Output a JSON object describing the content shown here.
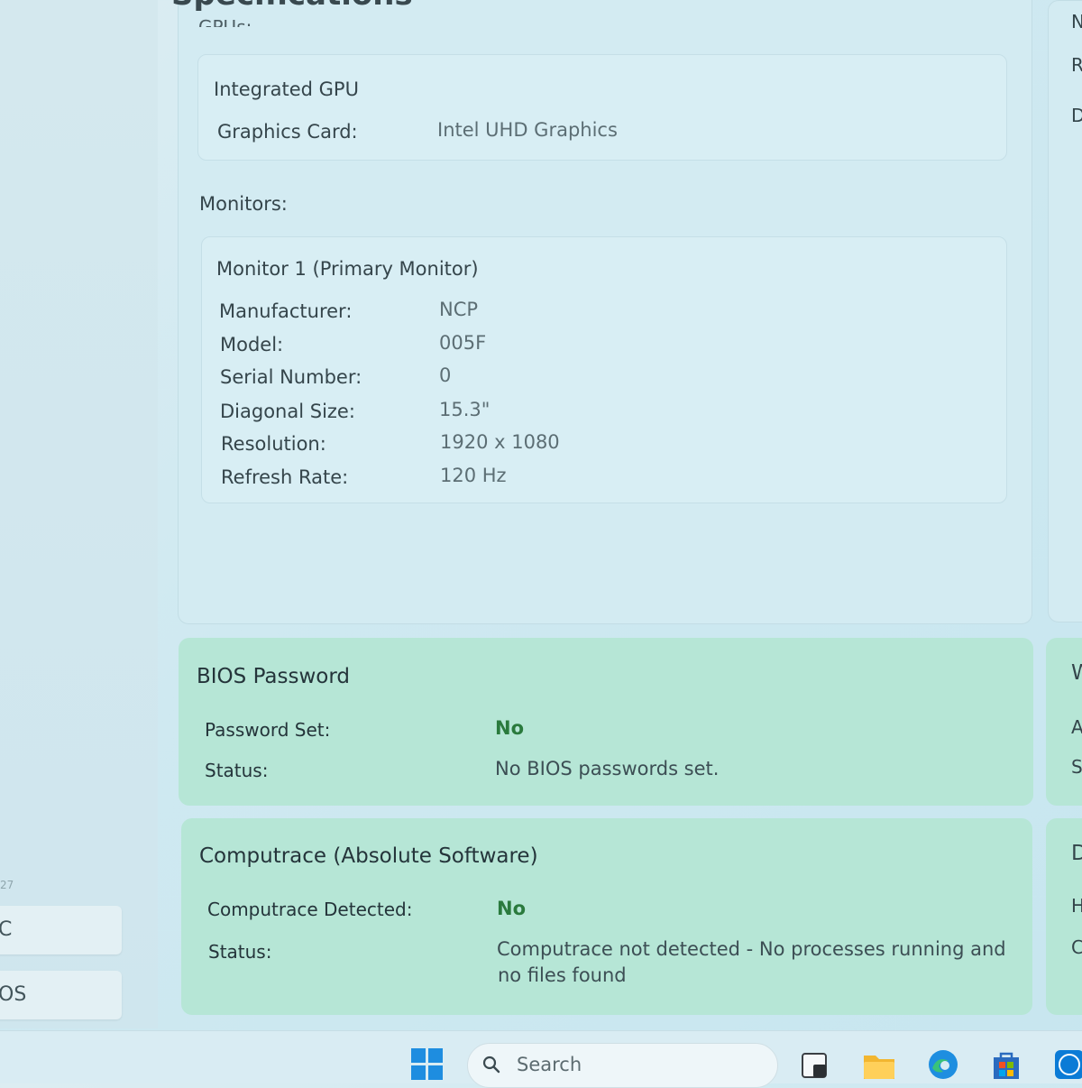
{
  "header": {
    "title": "Specifications",
    "gpu_heading": "GPUs:"
  },
  "gpu": {
    "card_title": "Integrated GPU",
    "graphics_label": "Graphics Card:",
    "graphics_value": "Intel UHD Graphics"
  },
  "monitors": {
    "section_label": "Monitors:",
    "card_title": "Monitor 1 (Primary Monitor)",
    "rows": [
      {
        "label": "Manufacturer:",
        "value": "NCP"
      },
      {
        "label": "Model:",
        "value": "005F"
      },
      {
        "label": "Serial Number:",
        "value": "0"
      },
      {
        "label": "Diagonal Size:",
        "value": "15.3\""
      },
      {
        "label": "Resolution:",
        "value": "1920 x 1080"
      },
      {
        "label": "Refresh Rate:",
        "value": "120 Hz"
      }
    ]
  },
  "bios": {
    "title": "BIOS Password",
    "rows": [
      {
        "label": "Password Set:",
        "value": "No"
      },
      {
        "label": "Status:",
        "value": "No BIOS passwords set."
      }
    ]
  },
  "computrace": {
    "title": "Computrace (Absolute Software)",
    "rows": [
      {
        "label": "Computrace Detected:",
        "value": "No"
      },
      {
        "label": "Status:",
        "value_line1": "Computrace not detected - No processes running and",
        "value_line2": "no files found"
      }
    ]
  },
  "sidebar": {
    "version_fragment": "27",
    "items": [
      {
        "label": "C"
      },
      {
        "label": "OS"
      }
    ]
  },
  "right_column_fragments": [
    "N",
    "R",
    "D",
    "W",
    "A",
    "S",
    "D",
    "H",
    "C"
  ],
  "taskbar": {
    "search_placeholder": "Search",
    "icons": [
      "windows-start-icon",
      "search-icon",
      "task-view-icon",
      "file-explorer-icon",
      "edge-browser-icon",
      "microsoft-store-icon",
      "dell-icon"
    ]
  },
  "colors": {
    "status_ok": "#2a7a3d",
    "green_card": "#b6e6d6",
    "accent": "#1e8de0"
  }
}
